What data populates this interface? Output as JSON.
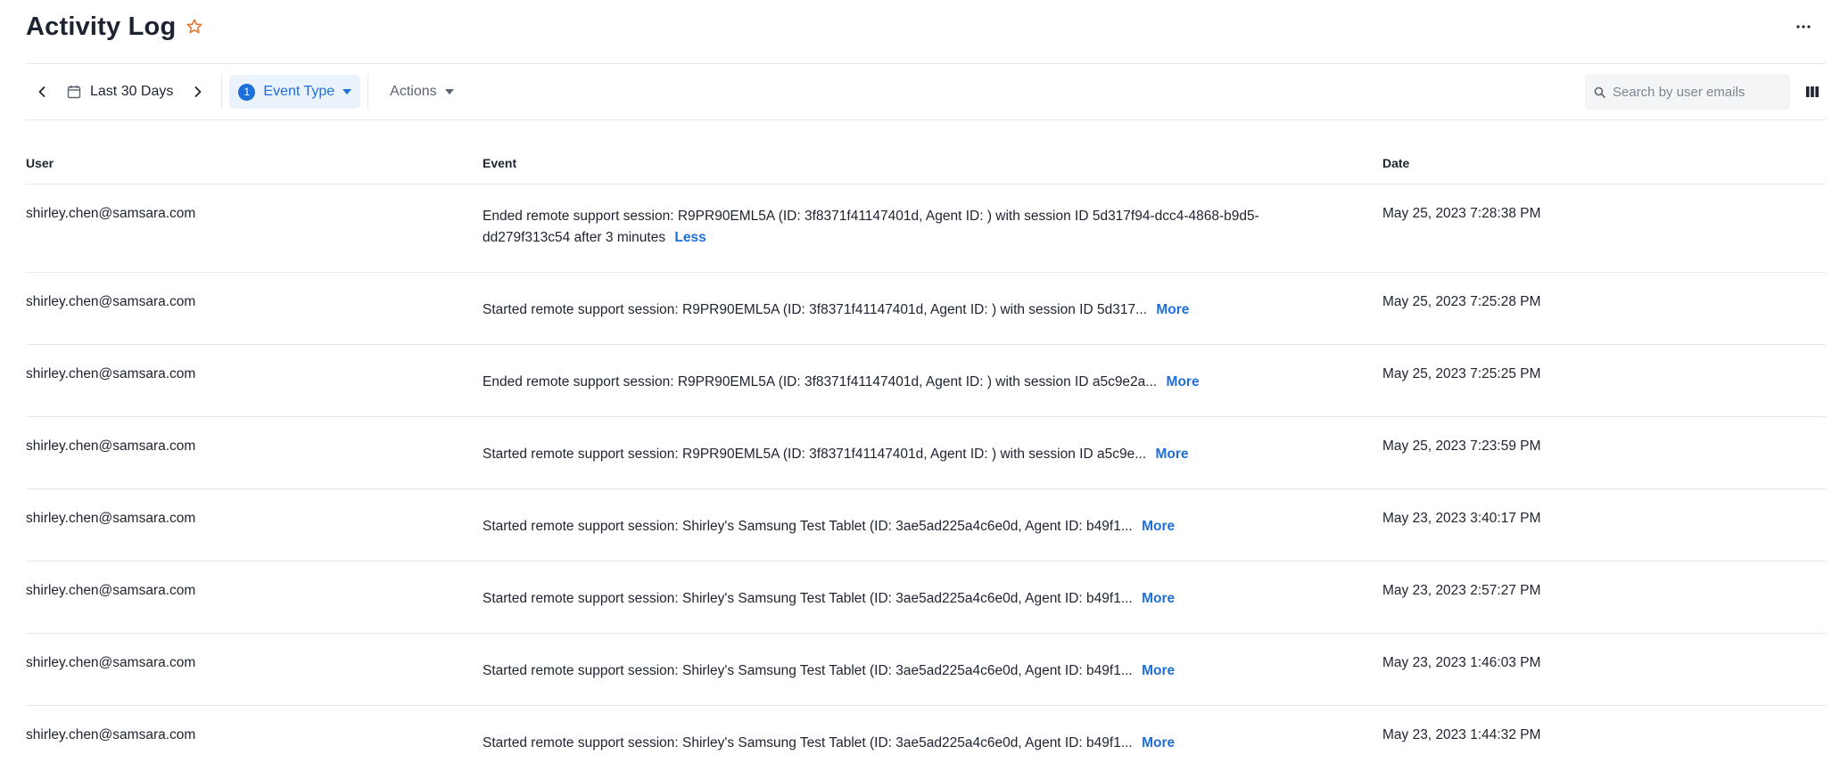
{
  "header": {
    "title": "Activity Log"
  },
  "toolbar": {
    "date_range": "Last 30 Days",
    "event_type_count": "1",
    "event_type_label": "Event Type",
    "actions_label": "Actions",
    "search_placeholder": "Search by user emails"
  },
  "table": {
    "columns": {
      "user": "User",
      "event": "Event",
      "date": "Date"
    },
    "rows": [
      {
        "user": "shirley.chen@samsara.com",
        "event": "Ended remote support session: R9PR90EML5A (ID: 3f8371f41147401d, Agent ID: ) with session ID 5d317f94-dcc4-4868-b9d5-dd279f313c54 after 3 minutes",
        "toggle": "Less",
        "date": "May 25, 2023 7:28:38 PM"
      },
      {
        "user": "shirley.chen@samsara.com",
        "event": "Started remote support session: R9PR90EML5A (ID: 3f8371f41147401d, Agent ID: ) with session ID 5d317...",
        "toggle": "More",
        "date": "May 25, 2023 7:25:28 PM"
      },
      {
        "user": "shirley.chen@samsara.com",
        "event": "Ended remote support session: R9PR90EML5A (ID: 3f8371f41147401d, Agent ID: ) with session ID a5c9e2a...",
        "toggle": "More",
        "date": "May 25, 2023 7:25:25 PM"
      },
      {
        "user": "shirley.chen@samsara.com",
        "event": "Started remote support session: R9PR90EML5A (ID: 3f8371f41147401d, Agent ID: ) with session ID a5c9e...",
        "toggle": "More",
        "date": "May 25, 2023 7:23:59 PM"
      },
      {
        "user": "shirley.chen@samsara.com",
        "event": "Started remote support session: Shirley's Samsung Test Tablet (ID: 3ae5ad225a4c6e0d, Agent ID: b49f1...",
        "toggle": "More",
        "date": "May 23, 2023 3:40:17 PM"
      },
      {
        "user": "shirley.chen@samsara.com",
        "event": "Started remote support session: Shirley's Samsung Test Tablet (ID: 3ae5ad225a4c6e0d, Agent ID: b49f1...",
        "toggle": "More",
        "date": "May 23, 2023 2:57:27 PM"
      },
      {
        "user": "shirley.chen@samsara.com",
        "event": "Started remote support session: Shirley's Samsung Test Tablet (ID: 3ae5ad225a4c6e0d, Agent ID: b49f1...",
        "toggle": "More",
        "date": "May 23, 2023 1:46:03 PM"
      },
      {
        "user": "shirley.chen@samsara.com",
        "event": "Started remote support session: Shirley's Samsung Test Tablet (ID: 3ae5ad225a4c6e0d, Agent ID: b49f1...",
        "toggle": "More",
        "date": "May 23, 2023 1:44:32 PM"
      }
    ]
  },
  "icons": {
    "favorite": "star-outline-icon",
    "menu": "more-horizontal-icon",
    "prev": "chevron-left-icon",
    "next": "chevron-right-icon",
    "calendar": "calendar-icon",
    "dropdown": "caret-down-icon",
    "search": "search-icon",
    "columns": "columns-icon"
  },
  "colors": {
    "accent": "#1e6fd9",
    "star": "#e8742f",
    "text": "#1d2330",
    "muted": "#5b6270",
    "divider": "#e3e6ea",
    "chip_bg": "#eaf2fc"
  }
}
